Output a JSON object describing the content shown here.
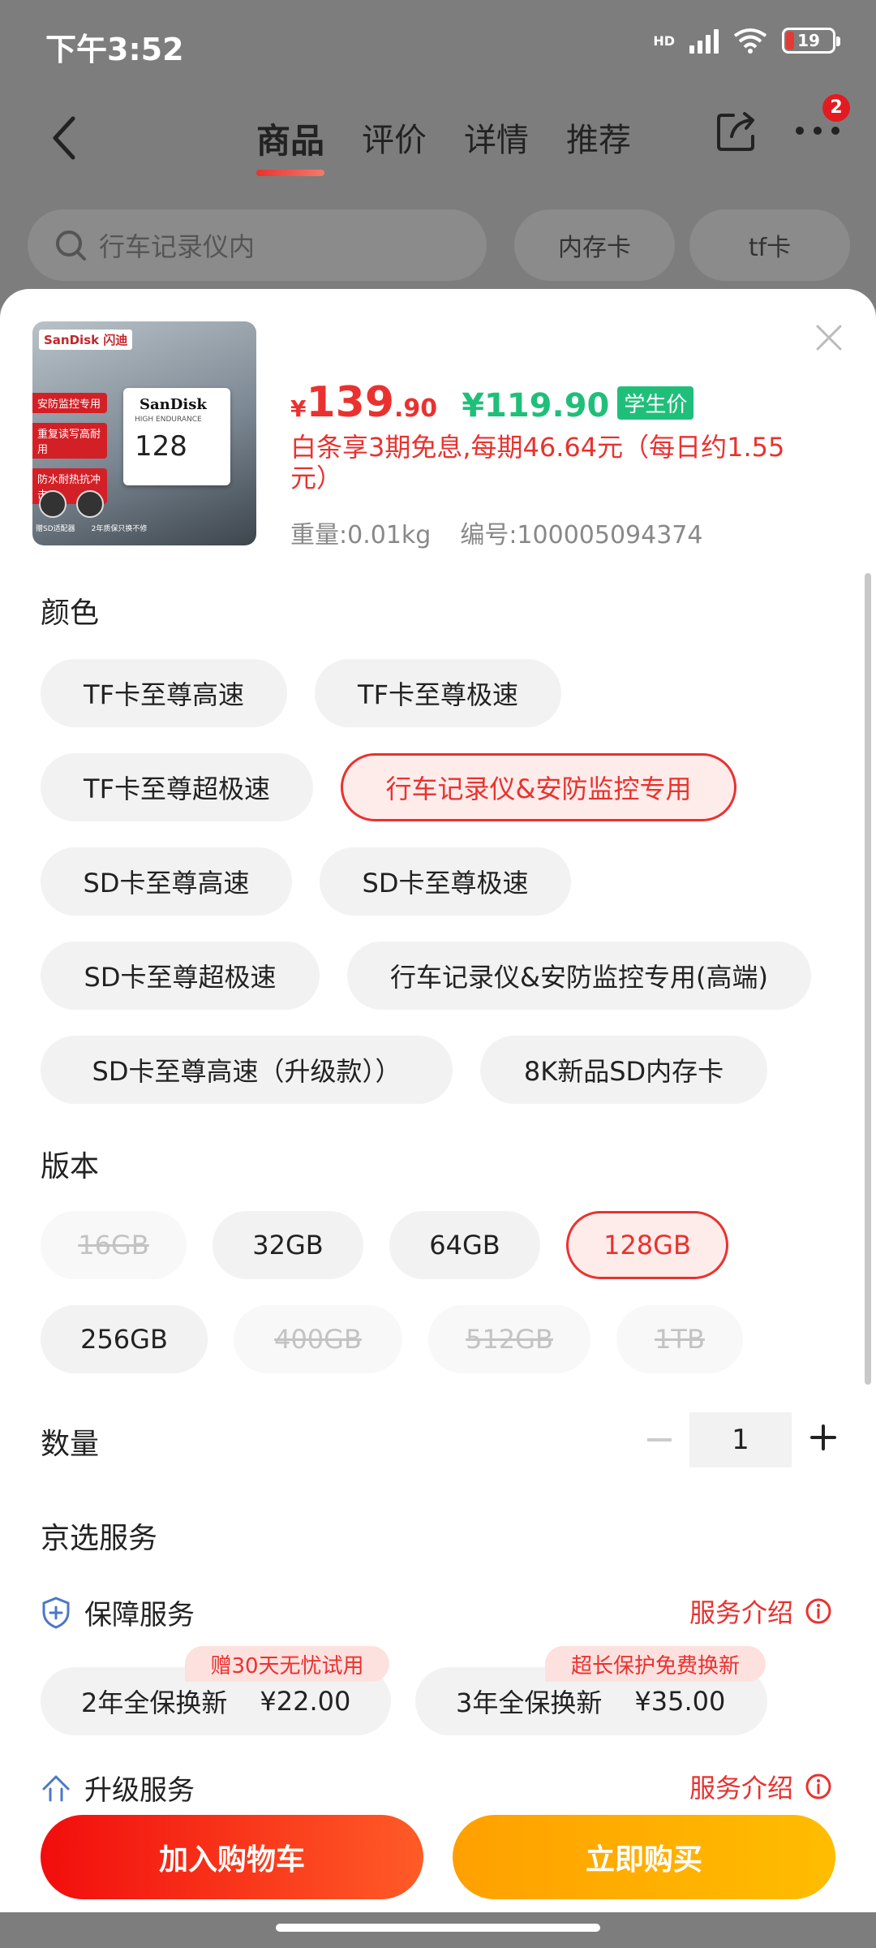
{
  "status": {
    "time": "下午3:52",
    "hd": "HD",
    "battery": "19"
  },
  "nav": {
    "tabs": [
      "商品",
      "评价",
      "详情",
      "推荐"
    ],
    "badge": "2"
  },
  "search": {
    "placeholder": "行车记录仪内",
    "chips": [
      "内存卡",
      "tf卡"
    ]
  },
  "product": {
    "thumb_brand": "SanDisk 闪迪",
    "thumb_card_brand": "SanDisk",
    "thumb_card_sub": "HIGH ENDURANCE",
    "thumb_capacity": "128",
    "thumb_tags": [
      "安防监控专用",
      "重复读写高耐用",
      "防水耐热抗冲击"
    ],
    "thumb_icon_labels": [
      "赠SD适配器",
      "2年质保只换不修"
    ],
    "yen": "¥",
    "price_int": "139",
    "price_dec": ".90",
    "student_price": "¥119.90",
    "student_tag": "学生价",
    "installment": "白条享3期免息,每期46.64元（每日约1.55元）",
    "weight": "重量:0.01kg",
    "sku": "编号:100005094374"
  },
  "color": {
    "title": "颜色",
    "options": [
      "TF卡至尊高速",
      "TF卡至尊极速",
      "TF卡至尊超极速",
      "行车记录仪&安防监控专用",
      "SD卡至尊高速",
      "SD卡至尊极速",
      "SD卡至尊超极速",
      "行车记录仪&安防监控专用(高端)",
      "SD卡至尊高速（升级款））",
      "8K新品SD内存卡"
    ],
    "selected": "行车记录仪&安防监控专用"
  },
  "version": {
    "title": "版本",
    "options": [
      "16GB",
      "32GB",
      "64GB",
      "128GB",
      "256GB",
      "400GB",
      "512GB",
      "1TB"
    ],
    "selected": "128GB",
    "disabled": [
      "16GB",
      "400GB",
      "512GB",
      "1TB"
    ]
  },
  "quantity": {
    "title": "数量",
    "value": "1"
  },
  "services": {
    "title": "京选服务",
    "protect": {
      "title": "保障服务",
      "link": "服务介绍",
      "cards": [
        {
          "name": "2年全保换新",
          "price": "¥22.00",
          "promo": "赠30天无忧试用"
        },
        {
          "name": "3年全保换新",
          "price": "¥35.00",
          "promo": "超长保护免费换新"
        }
      ]
    },
    "upgrade": {
      "title": "升级服务",
      "link": "服务介绍"
    }
  },
  "actions": {
    "cart": "加入购物车",
    "buy": "立即购买"
  },
  "colors": {
    "accent": "#e9322f",
    "green": "#1fbf7a",
    "buy": "#ffb000"
  }
}
